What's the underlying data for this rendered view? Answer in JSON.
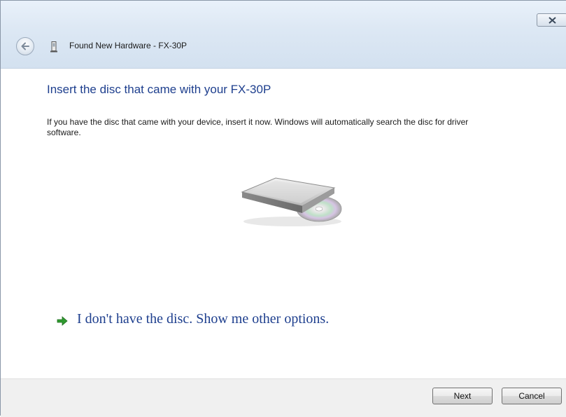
{
  "window": {
    "title": "Found New Hardware - FX-30P"
  },
  "main": {
    "heading": "Insert the disc that came with your FX-30P",
    "description": "If you have the disc that came with your device, insert it now.  Windows will automatically search the disc for driver software.",
    "illustration": "cd-drive-with-disc",
    "option": {
      "icon": "green-arrow-icon",
      "label": "I don't have the disc.  Show me other options."
    }
  },
  "footer": {
    "next_label": "Next",
    "cancel_label": "Cancel"
  },
  "colors": {
    "heading": "#1e3f8e",
    "titlebar": "#dde8f4",
    "footer": "#f0f0f0",
    "arrow": "#2f9a2f"
  }
}
